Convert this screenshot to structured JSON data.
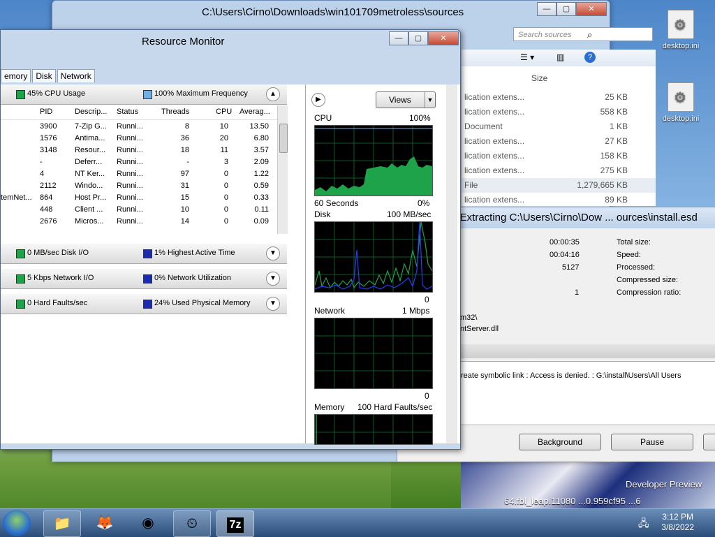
{
  "explorer": {
    "title": "C:\\Users\\Cirno\\Downloads\\win101709metroless\\sources",
    "search_placeholder": "Search sources",
    "size_header": "Size",
    "rows": [
      {
        "name": "lication extens...",
        "size": "25 KB"
      },
      {
        "name": "lication extens...",
        "size": "558 KB"
      },
      {
        "name": "Document",
        "size": "1 KB"
      },
      {
        "name": "lication extens...",
        "size": "27 KB"
      },
      {
        "name": "lication extens...",
        "size": "158 KB"
      },
      {
        "name": "lication extens...",
        "size": "275 KB"
      },
      {
        "name": "File",
        "size": "1,279,665 KB"
      },
      {
        "name": "lication extens...",
        "size": "89 KB"
      }
    ]
  },
  "desktop": {
    "icon1": "desktop.ini",
    "icon2": "desktop.ini",
    "watermark1": "Developer Preview",
    "watermark2": "64.fbl_leap.11080 ...0.959cf95 ...6"
  },
  "zip": {
    "title": "s Extracting C:\\Users\\Cirno\\Dow ... ources\\install.esd",
    "elapsed": "00:00:35",
    "remaining": "00:04:16",
    "files": "5127",
    "errors": "1",
    "total_size_label": "Total size:",
    "speed_label": "Speed:",
    "processed_label": "Processed:",
    "compressed_label": "Compressed size:",
    "ratio_label": "Compression ratio:",
    "path1": "m32\\",
    "path2": "ntServer.dll",
    "error_msg": "reate symbolic link : Access is denied. : G:\\install\\Users\\All Users",
    "background_btn": "Background",
    "pause_btn": "Pause"
  },
  "resmon": {
    "title": "Resource Monitor",
    "tabs": [
      "emory",
      "Disk",
      "Network"
    ],
    "cpu_header": {
      "left": "45% CPU Usage",
      "right": "100% Maximum Frequency"
    },
    "disk_header": {
      "left": "0 MB/sec Disk I/O",
      "right": "1% Highest Active Time"
    },
    "net_header": {
      "left": "5 Kbps Network I/O",
      "right": "0% Network Utilization"
    },
    "mem_header": {
      "left": "0 Hard Faults/sec",
      "right": "24% Used Physical Memory"
    },
    "columns": {
      "pid": "PID",
      "desc": "Descrip...",
      "status": "Status",
      "threads": "Threads",
      "cpu": "CPU",
      "avg": "Averag..."
    },
    "processes": [
      {
        "name": "",
        "pid": "3900",
        "desc": "7-Zip G...",
        "status": "Runni...",
        "threads": "8",
        "cpu": "10",
        "avg": "13.50"
      },
      {
        "name": "",
        "pid": "1576",
        "desc": "Antima...",
        "status": "Runni...",
        "threads": "36",
        "cpu": "20",
        "avg": "6.80"
      },
      {
        "name": "",
        "pid": "3148",
        "desc": "Resour...",
        "status": "Runni...",
        "threads": "18",
        "cpu": "11",
        "avg": "3.57"
      },
      {
        "name": "",
        "pid": "-",
        "desc": "Deferr...",
        "status": "Runni...",
        "threads": "-",
        "cpu": "3",
        "avg": "2.09"
      },
      {
        "name": "",
        "pid": "4",
        "desc": "NT Ker...",
        "status": "Runni...",
        "threads": "97",
        "cpu": "0",
        "avg": "1.22"
      },
      {
        "name": "",
        "pid": "2112",
        "desc": "Windo...",
        "status": "Runni...",
        "threads": "31",
        "cpu": "0",
        "avg": "0.59"
      },
      {
        "name": "temNet...",
        "pid": "864",
        "desc": "Host Pr...",
        "status": "Runni...",
        "threads": "15",
        "cpu": "0",
        "avg": "0.33"
      },
      {
        "name": "",
        "pid": "448",
        "desc": "Client ...",
        "status": "Runni...",
        "threads": "10",
        "cpu": "0",
        "avg": "0.11"
      },
      {
        "name": "",
        "pid": "2676",
        "desc": "Micros...",
        "status": "Runni...",
        "threads": "14",
        "cpu": "0",
        "avg": "0.09"
      }
    ],
    "views_btn": "Views",
    "graphs": {
      "cpu": {
        "label": "CPU",
        "max": "100%",
        "time": "60 Seconds",
        "min": "0%"
      },
      "disk": {
        "label": "Disk",
        "max": "100 MB/sec",
        "min": "0"
      },
      "network": {
        "label": "Network",
        "max": "1 Mbps",
        "min": "0"
      },
      "memory": {
        "label": "Memory",
        "max": "100 Hard Faults/sec"
      }
    }
  },
  "taskbar": {
    "time": "3:12 PM",
    "date": "3/8/2022",
    "zip_label": "7z"
  }
}
